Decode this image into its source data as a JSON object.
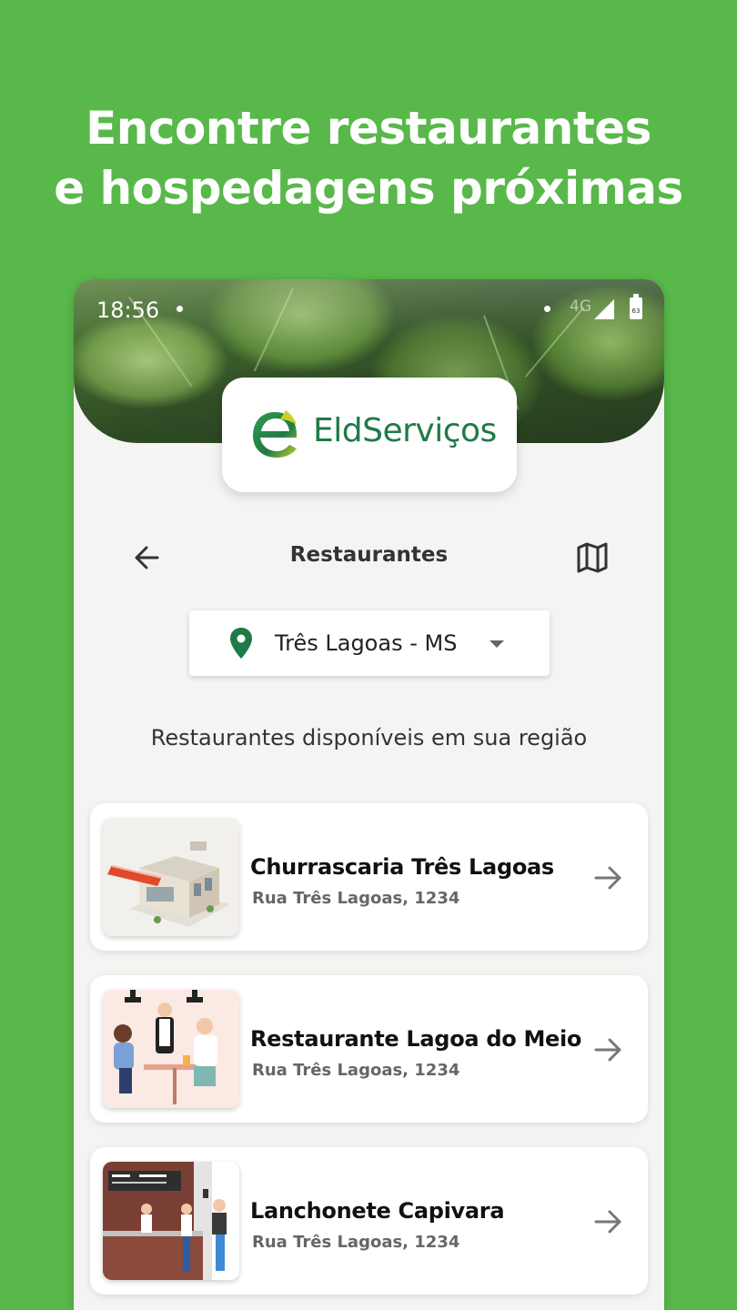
{
  "promo": {
    "headline_line1": "Encontre restaurantes",
    "headline_line2": "e hospedagens próximas"
  },
  "status_bar": {
    "time": "18:56",
    "network": "4G",
    "battery": "63"
  },
  "brand": {
    "name": "EldServiços",
    "color": "#1f7a47"
  },
  "header": {
    "title": "Restaurantes",
    "back_icon": "arrow-left-icon",
    "map_icon": "map-icon"
  },
  "location": {
    "selected": "Três Lagoas - MS",
    "icon": "location-pin-icon"
  },
  "list": {
    "subtitle": "Restaurantes disponíveis em sua região",
    "items": [
      {
        "name": "Churrascaria Três Lagoas",
        "address": "Rua Três Lagoas, 1234"
      },
      {
        "name": "Restaurante Lagoa do Meio",
        "address": "Rua Três Lagoas, 1234"
      },
      {
        "name": "Lanchonete Capivara",
        "address": "Rua Três Lagoas, 1234"
      }
    ]
  },
  "colors": {
    "background": "#58b84a",
    "accent": "#1f7a47"
  }
}
